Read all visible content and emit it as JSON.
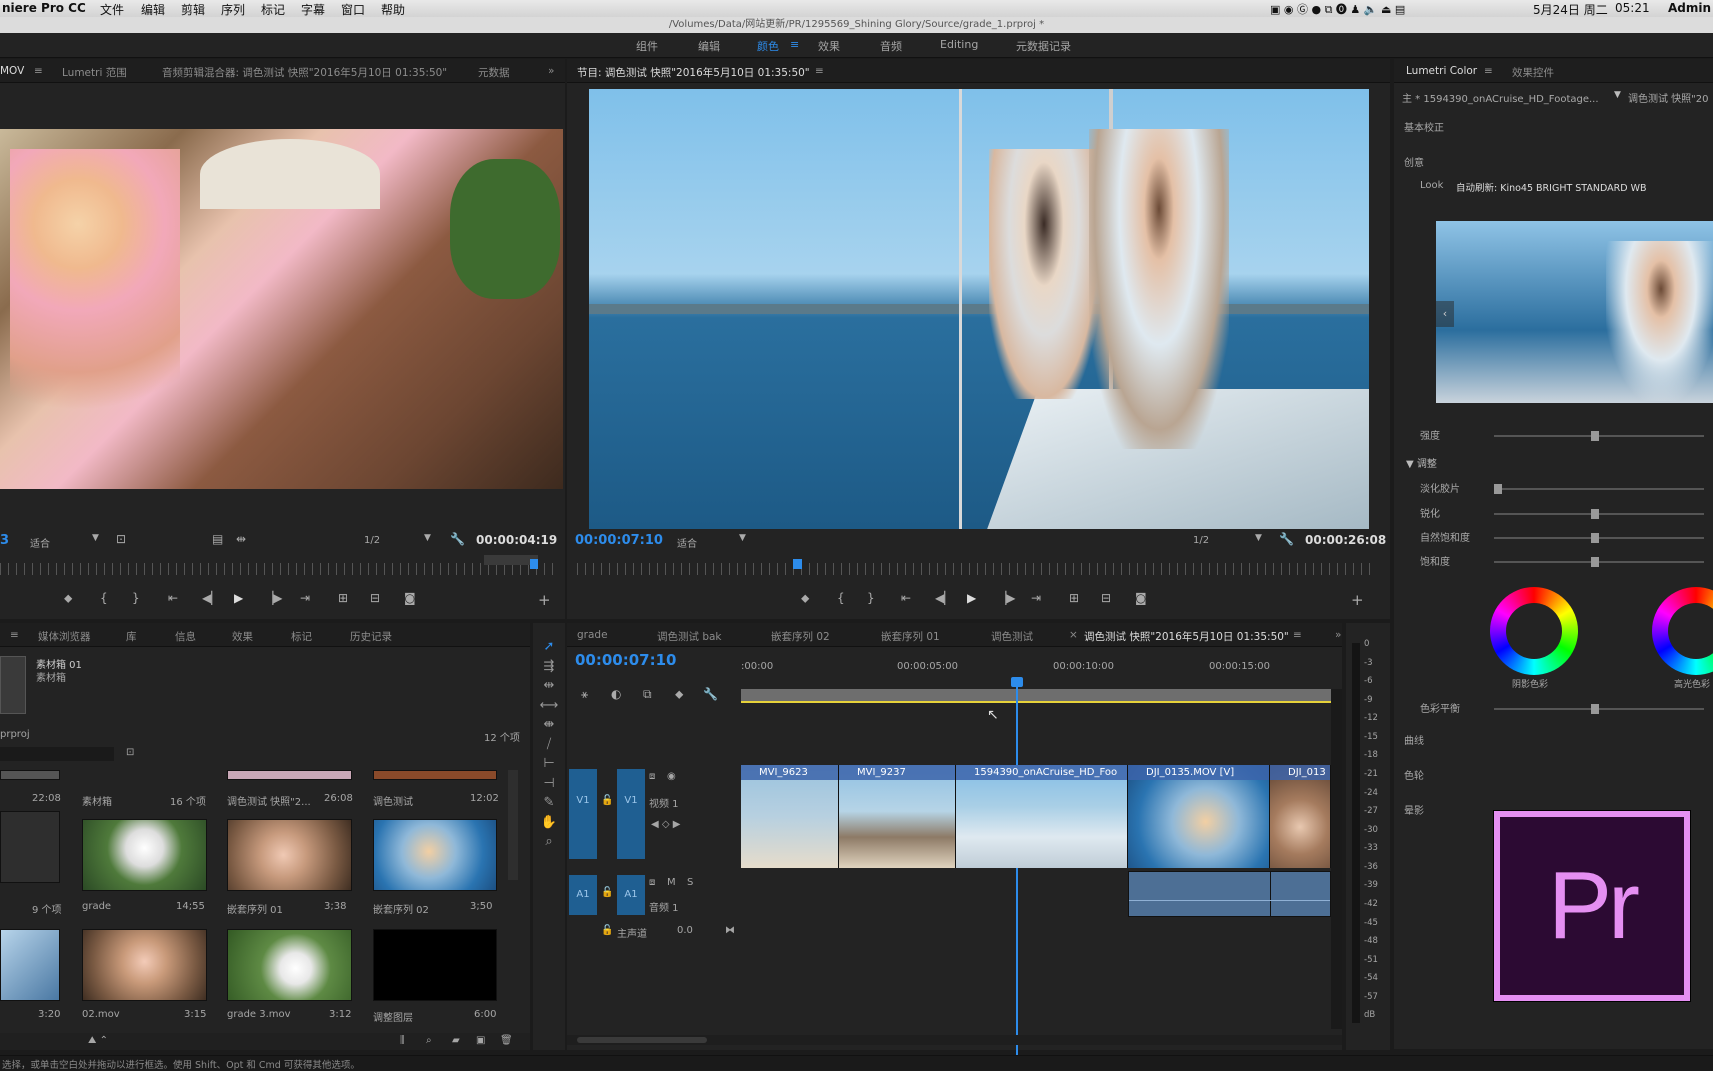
{
  "menubar": {
    "app": "niere Pro CC",
    "items": [
      "文件",
      "编辑",
      "剪辑",
      "序列",
      "标记",
      "字幕",
      "窗口",
      "帮助"
    ],
    "date": "5月24日 周二",
    "time": "05:21",
    "user": "Admin"
  },
  "titlebar": {
    "path": "/Volumes/Data/网站更新/PR/1295569_Shining Glory/Source/grade_1.prproj *"
  },
  "workspaces": [
    "组件",
    "编辑",
    "颜色",
    "效果",
    "音频",
    "Editing",
    "元数据记录"
  ],
  "source": {
    "tabs": [
      "MOV",
      "Lumetri 范围",
      "音频剪辑混合器: 调色测试 快照\"2016年5月10日 01:35:50\"",
      "元数据"
    ],
    "left_tc": "3",
    "fit": "适合",
    "res": "1/2",
    "tc": "00:00:04:19"
  },
  "program": {
    "title": "节目: 调色测试 快照\"2016年5月10日 01:35:50\"",
    "tc": "00:00:07:10",
    "fit": "适合",
    "res": "1/2",
    "duration": "00:00:26:08"
  },
  "lumetri": {
    "tabs": [
      "Lumetri Color",
      "效果控件"
    ],
    "master": "主 * 1594390_onACruise_HD_Footage...",
    "seq": "调色测试 快照\"20",
    "basic": "基本校正",
    "creative": "创意",
    "look_label": "Look",
    "look_value": "自动刷新: Kino45 BRIGHT STANDARD WB",
    "intensity": "强度",
    "adjust": "调整",
    "faded": "淡化胶片",
    "sharpen": "锐化",
    "vibrance": "自然饱和度",
    "saturation": "饱和度",
    "shadow_tint": "阴影色彩",
    "highlight_tint": "高光色彩",
    "balance": "色彩平衡",
    "curves": "曲线",
    "wheels": "色轮",
    "vignette": "晕影",
    "sliders": {
      "intensity": 0.48,
      "faded": 0.0,
      "sharpen": 0.48,
      "vibrance": 0.48,
      "saturation": 0.48,
      "balance": 0.48
    }
  },
  "project": {
    "tabs": [
      "媒体浏览器",
      "库",
      "信息",
      "效果",
      "标记",
      "历史记录"
    ],
    "bin_name": "素材箱 01",
    "bin_type": "素材箱",
    "proj": "prproj",
    "count": "12 个项",
    "items": [
      {
        "name": "",
        "dur": "22:08"
      },
      {
        "name": "素材箱",
        "dur": "16 个项"
      },
      {
        "name": "调色测试 快照\"2...",
        "dur": "26:08"
      },
      {
        "name": "调色测试",
        "dur": "12:02"
      },
      {
        "name": "",
        "dur": "9 个项"
      },
      {
        "name": "grade",
        "dur": "14;55"
      },
      {
        "name": "嵌套序列 01",
        "dur": "3;38"
      },
      {
        "name": "嵌套序列 02",
        "dur": "3;50"
      },
      {
        "name": "",
        "dur": "3:20"
      },
      {
        "name": "02.mov",
        "dur": "3:15"
      },
      {
        "name": "grade 3.mov",
        "dur": "3:12"
      },
      {
        "name": "调整图层",
        "dur": "6:00"
      }
    ]
  },
  "timeline": {
    "tabs": [
      "grade",
      "调色测试 bak",
      "嵌套序列 02",
      "嵌套序列 01",
      "调色测试",
      "调色测试 快照\"2016年5月10日 01:35:50\""
    ],
    "tc": "00:00:07:10",
    "ruler": [
      ":00:00",
      "00:00:05:00",
      "00:00:10:00",
      "00:00:15:00"
    ],
    "v1": "V1",
    "a1": "A1",
    "video1": "视频 1",
    "audio1": "音频 1",
    "master": "主声道",
    "master_val": "0.0",
    "m": "M",
    "s": "S",
    "clips": [
      "MVI_9623",
      "MVI_9237",
      "1594390_onACruise_HD_Foo",
      "DJI_0135.MOV [V]",
      "DJI_013"
    ]
  },
  "meter": [
    "0",
    "-3",
    "-6",
    "-9",
    "-12",
    "-15",
    "-18",
    "-21",
    "-24",
    "-27",
    "-30",
    "-33",
    "-36",
    "-39",
    "-42",
    "-45",
    "-48",
    "-51",
    "-54",
    "-57",
    "dB"
  ],
  "status": "选择，或单击空白处并拖动以进行框选。使用 Shift、Opt 和 Cmd 可获得其他选项。",
  "logo": "Pr"
}
